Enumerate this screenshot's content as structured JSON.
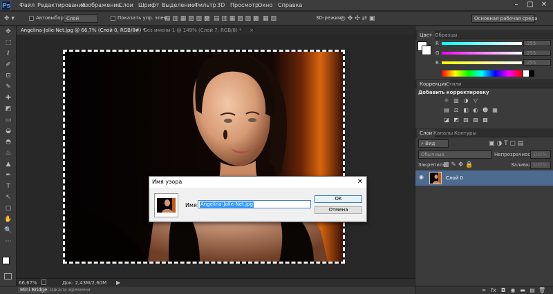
{
  "app": {
    "logo": "Ps"
  },
  "menu": [
    "Файл",
    "Редактирование",
    "Изображение",
    "Слои",
    "Шрифт",
    "Выделение",
    "Фильтр",
    "3D",
    "Просмотр",
    "Окно",
    "Справка"
  ],
  "window_controls": {
    "minimize": "–",
    "maximize": "□",
    "close": "✕"
  },
  "options": {
    "autoselect_label": "Автовыбор:",
    "autoselect_value": "Слой",
    "show_controls_label": "Показать упр. элем.",
    "mode_3d_label": "3D-режим:",
    "workspace": "Основная рабочая среда"
  },
  "tabs": [
    {
      "label": "Angelina-Jolie-Net.jpg @ 66,7% (Слой 0, RGB/8#) *",
      "active": true
    },
    {
      "label": "Без имени-1 @ 149% (Слой 7, RGB/8) *",
      "active": false
    }
  ],
  "tab_close": "×",
  "tools": [
    "✥",
    "⬚",
    "ℓ",
    "✐",
    "⊡",
    "✎",
    "✚",
    "◩",
    "▭",
    "◒",
    "◓",
    "♨",
    "▲",
    "✒",
    "T",
    "↖",
    "▢",
    "✋",
    "🔍",
    "⋯"
  ],
  "status": {
    "zoom": "66,67%",
    "doc": "Док: 2,43M/2,60M"
  },
  "bottom_tabs": [
    "Mini Bridge",
    "Шкала времени"
  ],
  "color_panel": {
    "tabs": [
      "Цвет",
      "Образцы"
    ],
    "channels": [
      {
        "label": "R",
        "value": "255"
      },
      {
        "label": "G",
        "value": "255"
      },
      {
        "label": "B",
        "value": "255"
      }
    ]
  },
  "adjust_panel": {
    "tabs": [
      "Коррекция",
      "Стили"
    ],
    "title": "Добавить корректировку",
    "icons_row1": [
      "☼",
      "▥",
      "◑",
      "▽"
    ],
    "icons_row2": [
      "▤",
      "⚖",
      "◧",
      "◐",
      "☻",
      "▦"
    ],
    "icons_row3": [
      "◪",
      "◩",
      "▨",
      "▧",
      "▩"
    ]
  },
  "layers_panel": {
    "tabs": [
      "Слои",
      "Каналы",
      "Контуры"
    ],
    "filter": "Вид",
    "blend": "Обычные",
    "opacity_label": "Непрозрачность:",
    "opacity": "100%",
    "lock_label": "Закрепить:",
    "fill_label": "Заливка:",
    "fill": "100%",
    "layer_name": "Слой 0",
    "bottom_icons": [
      "∞",
      "fx",
      "◘",
      "◉",
      "▬",
      "▤",
      "🗑"
    ]
  },
  "dialog": {
    "title": "Имя узора",
    "close": "✕",
    "name_label": "Имя:",
    "name_value": "Angelina-Jolie-Net.jpg",
    "ok": "OK",
    "cancel": "Отмена"
  }
}
